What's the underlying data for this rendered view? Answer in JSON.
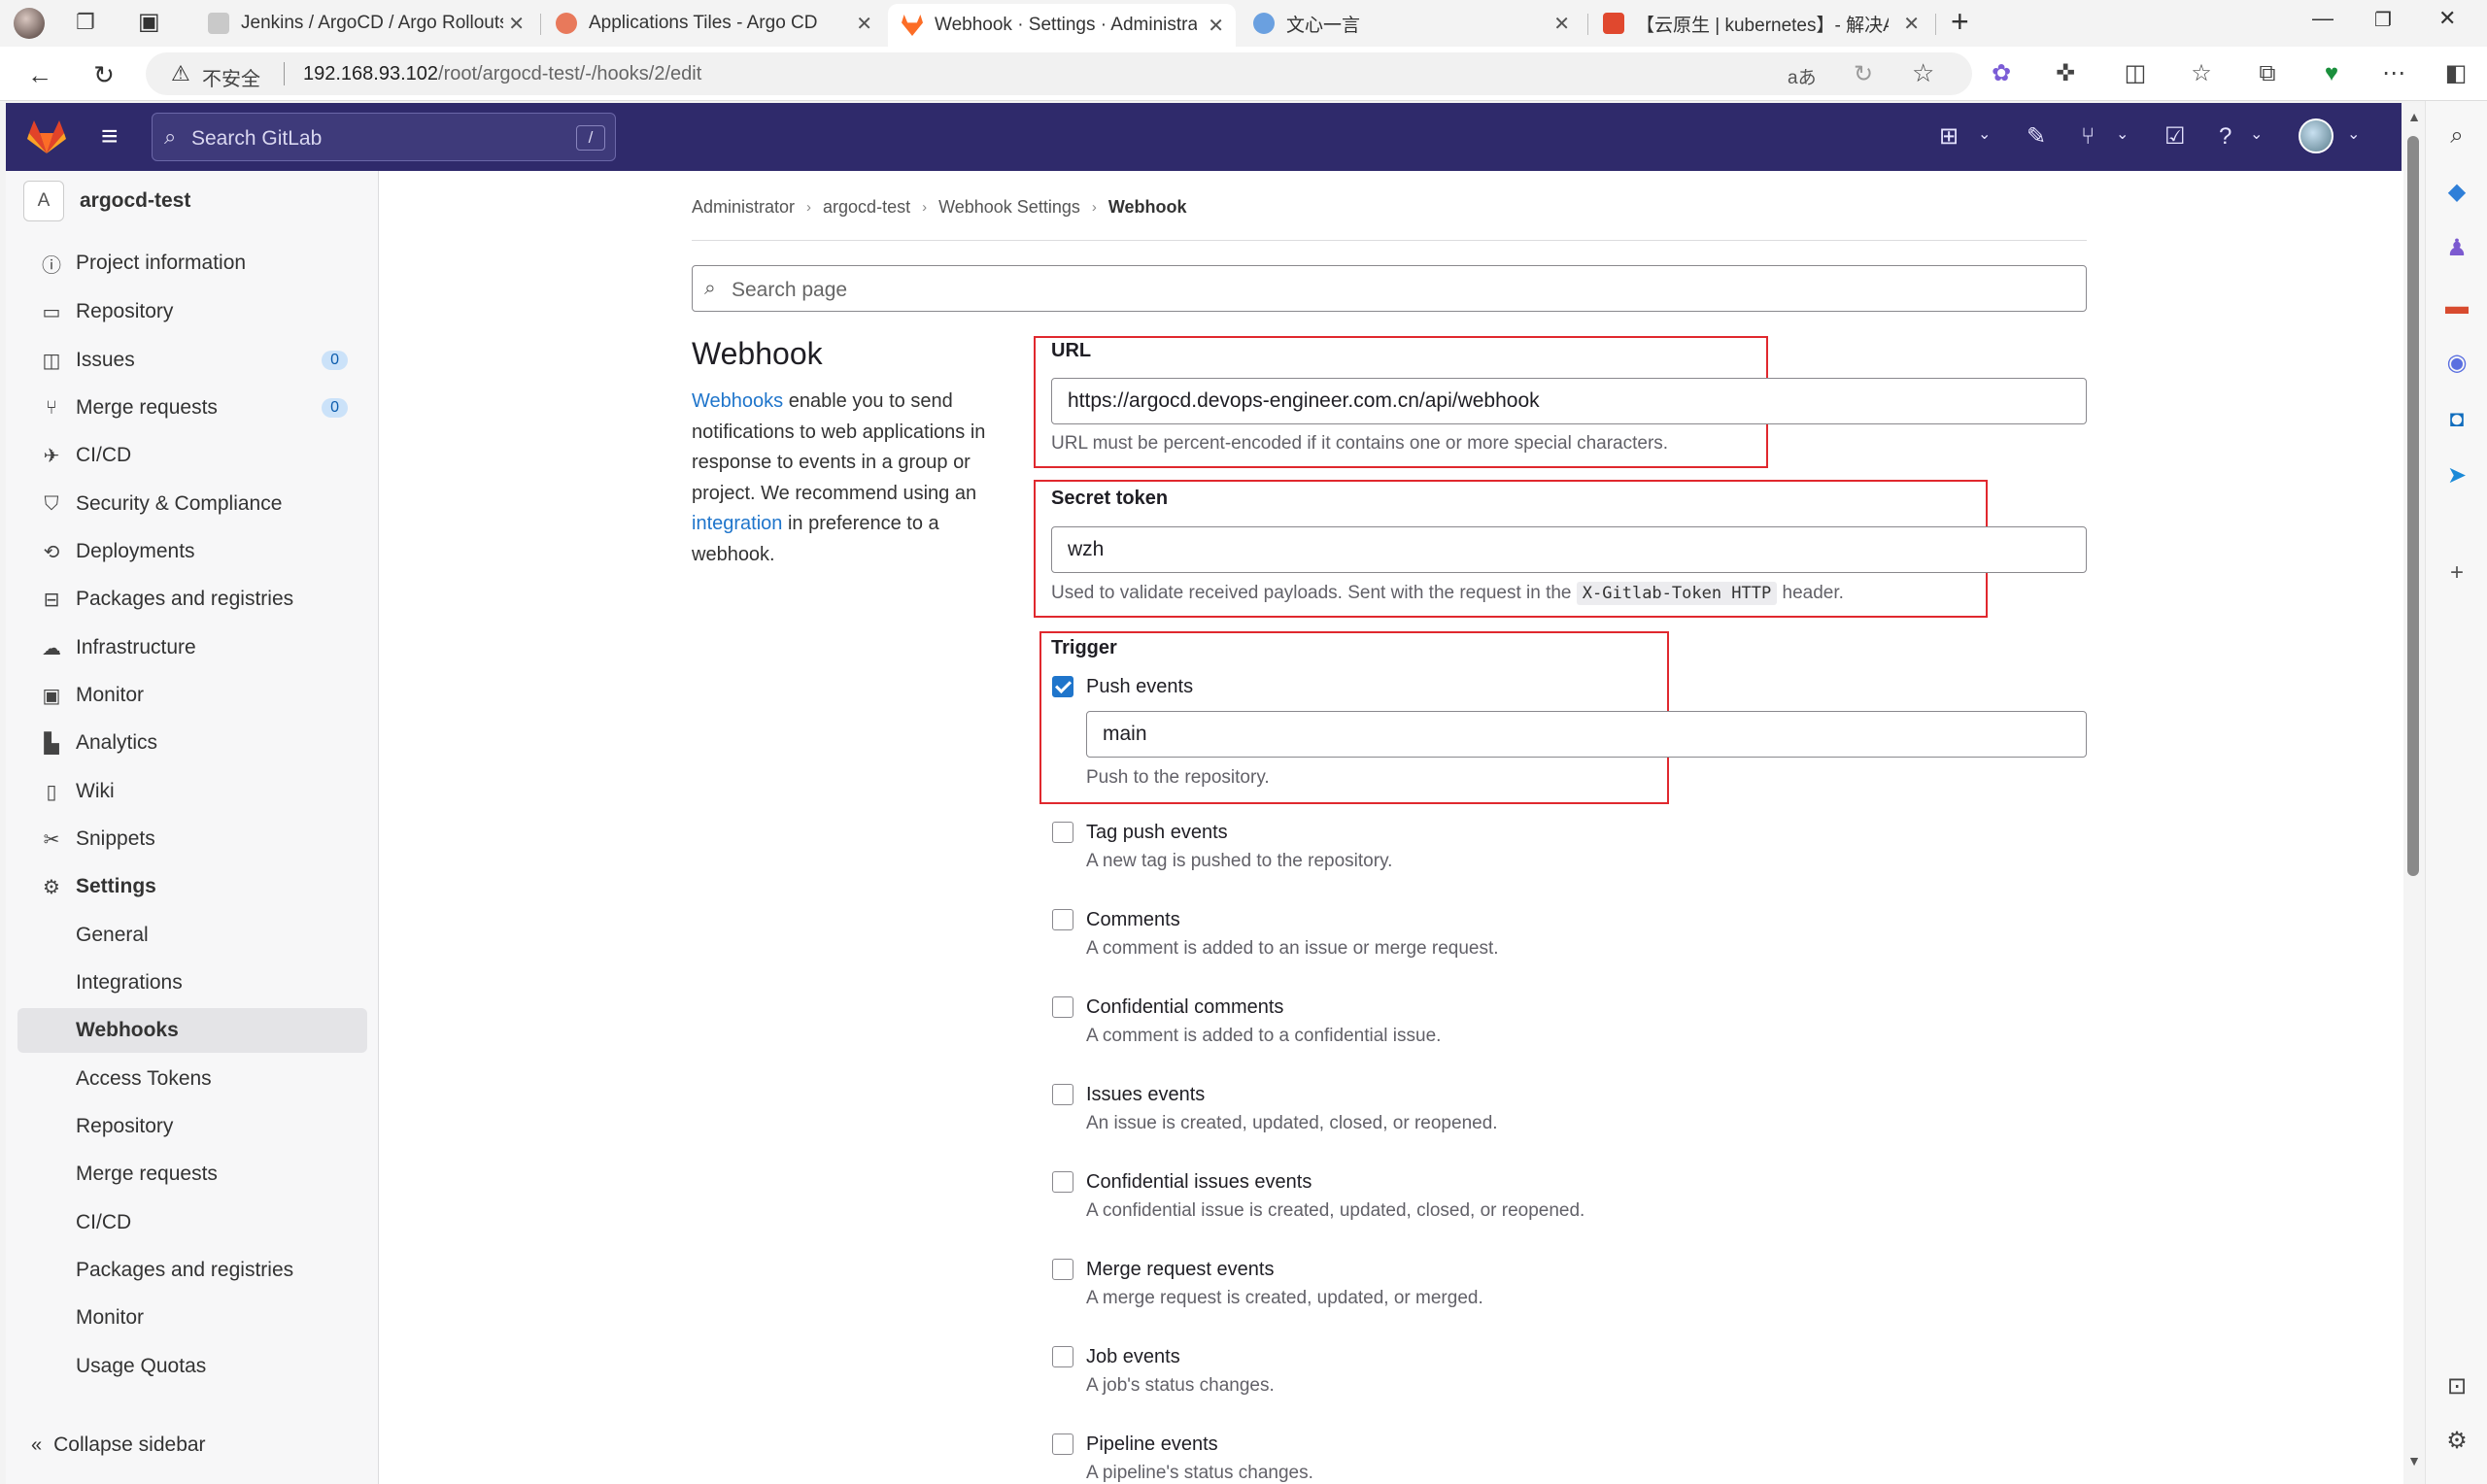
{
  "browser": {
    "tabs": [
      {
        "title": "Jenkins / ArgoCD / Argo Rollouts",
        "fav_color": "#c9c9c9"
      },
      {
        "title": "Applications Tiles - Argo CD",
        "fav_color": "#e8795b"
      },
      {
        "title": "Webhook · Settings · Administrat",
        "fav_color": "#fc6d26"
      },
      {
        "title": "文心一言",
        "fav_color": "#6aa0e0"
      },
      {
        "title": "【云原生 | kubernetes】- 解决A",
        "fav_color": "#e0482e"
      }
    ],
    "insecure_label": "不安全",
    "url_host": "192.168.93.102",
    "url_path": "/root/argocd-test/-/hooks/2/edit"
  },
  "header": {
    "search_placeholder": "Search GitLab",
    "search_shortcut": "/"
  },
  "sidebar": {
    "project_initial": "A",
    "project_name": "argocd-test",
    "items": [
      {
        "label": "Project information",
        "icon": "info-icon"
      },
      {
        "label": "Repository",
        "icon": "repository-icon"
      },
      {
        "label": "Issues",
        "icon": "issues-icon",
        "badge": "0"
      },
      {
        "label": "Merge requests",
        "icon": "merge-request-icon",
        "badge": "0"
      },
      {
        "label": "CI/CD",
        "icon": "rocket-icon"
      },
      {
        "label": "Security & Compliance",
        "icon": "shield-icon"
      },
      {
        "label": "Deployments",
        "icon": "deployments-icon"
      },
      {
        "label": "Packages and registries",
        "icon": "package-icon"
      },
      {
        "label": "Infrastructure",
        "icon": "cloud-icon"
      },
      {
        "label": "Monitor",
        "icon": "monitor-icon"
      },
      {
        "label": "Analytics",
        "icon": "chart-icon"
      },
      {
        "label": "Wiki",
        "icon": "book-icon"
      },
      {
        "label": "Snippets",
        "icon": "scissors-icon"
      },
      {
        "label": "Settings",
        "icon": "gear-icon"
      }
    ],
    "settings_sub": [
      "General",
      "Integrations",
      "Webhooks",
      "Access Tokens",
      "Repository",
      "Merge requests",
      "CI/CD",
      "Packages and registries",
      "Monitor",
      "Usage Quotas"
    ],
    "collapse_label": "Collapse sidebar"
  },
  "breadcrumb": [
    "Administrator",
    "argocd-test",
    "Webhook Settings",
    "Webhook"
  ],
  "search_page_placeholder": "Search page",
  "page": {
    "title": "Webhook",
    "desc_link1": "Webhooks",
    "desc_mid": " enable you to send notifications to web applications in response to events in a group or project. We recommend using an ",
    "desc_link2": "integration",
    "desc_end": " in preference to a webhook."
  },
  "form": {
    "url_label": "URL",
    "url_value": "https://argocd.devops-engineer.com.cn/api/webhook",
    "url_help": "URL must be percent-encoded if it contains one or more special characters.",
    "token_label": "Secret token",
    "token_value": "wzh",
    "token_help_pre": "Used to validate received payloads. Sent with the request in the ",
    "token_help_code": "X-Gitlab-Token HTTP",
    "token_help_post": " header.",
    "trigger_label": "Trigger",
    "push_label": "Push events",
    "push_branch": "main",
    "push_help": "Push to the repository.",
    "triggers": [
      {
        "label": "Tag push events",
        "help": "A new tag is pushed to the repository."
      },
      {
        "label": "Comments",
        "help": "A comment is added to an issue or merge request."
      },
      {
        "label": "Confidential comments",
        "help": "A comment is added to a confidential issue."
      },
      {
        "label": "Issues events",
        "help": "An issue is created, updated, closed, or reopened."
      },
      {
        "label": "Confidential issues events",
        "help": "A confidential issue is created, updated, closed, or reopened."
      },
      {
        "label": "Merge request events",
        "help": "A merge request is created, updated, or merged."
      },
      {
        "label": "Job events",
        "help": "A job's status changes."
      },
      {
        "label": "Pipeline events",
        "help": "A pipeline's status changes."
      }
    ]
  },
  "colors": {
    "header_bg": "#2f2a6b",
    "link": "#1f75cb",
    "highlight_box": "#e0282e",
    "checkbox_checked": "#1f75cb"
  }
}
